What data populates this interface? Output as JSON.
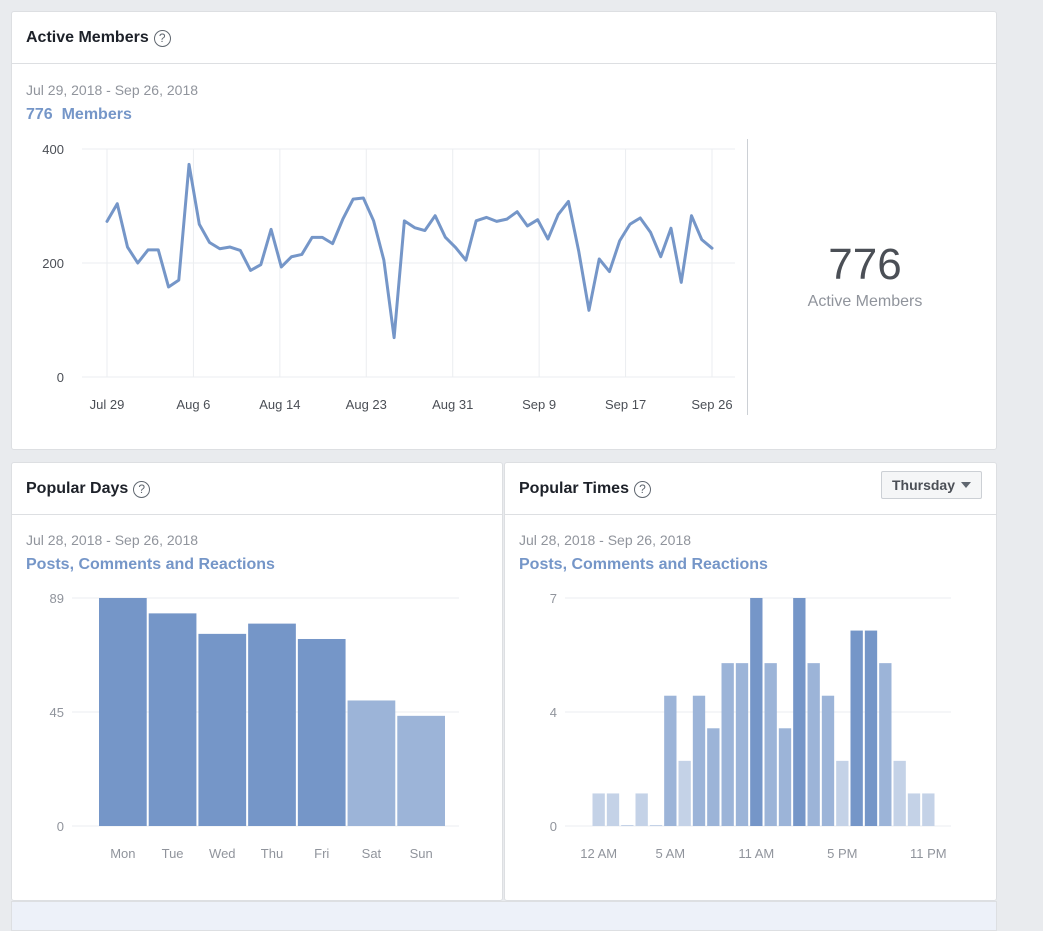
{
  "active_members": {
    "title": "Active Members",
    "help_icon": "?",
    "date_range": "Jul 29, 2018 - Sep 26, 2018",
    "metric_link": "776  Members",
    "summary_value": "776",
    "summary_label": "Active Members"
  },
  "popular_days": {
    "title": "Popular Days",
    "help_icon": "?",
    "date_range": "Jul 28, 2018 - Sep 26, 2018",
    "metric_link": "Posts, Comments and Reactions"
  },
  "popular_times": {
    "title": "Popular Times",
    "help_icon": "?",
    "date_range": "Jul 28, 2018 - Sep 26, 2018",
    "metric_link": "Posts, Comments and Reactions",
    "day_selector": "Thursday"
  },
  "colors": {
    "line": "#7596c8",
    "bar_dark": "#7596c8",
    "bar_medium": "#9cb4d8",
    "bar_light": "#c4d2e7",
    "grid": "#ebedf0",
    "tick_text": "#90949c",
    "axis_text": "#4b4f56"
  },
  "chart_data": [
    {
      "type": "line",
      "title": "Active Members",
      "xlabel": "",
      "ylabel": "",
      "ylim": [
        0,
        400
      ],
      "yticks": [
        "0",
        "200",
        "400"
      ],
      "xticks": [
        "Jul 29",
        "Aug 6",
        "Aug 14",
        "Aug 23",
        "Aug 31",
        "Sep 9",
        "Sep 17",
        "Sep 26"
      ],
      "grid": true,
      "x_start": "Jul 29",
      "x_end": "Sep 26",
      "values": [
        273,
        304,
        228,
        200,
        223,
        223,
        158,
        170,
        373,
        268,
        236,
        225,
        228,
        222,
        187,
        197,
        259,
        193,
        211,
        215,
        245,
        245,
        234,
        277,
        312,
        314,
        274,
        205,
        69,
        274,
        262,
        257,
        283,
        245,
        227,
        205,
        274,
        280,
        273,
        277,
        290,
        265,
        276,
        242,
        285,
        308,
        221,
        117,
        207,
        185,
        239,
        268,
        279,
        254,
        211,
        261,
        166,
        283,
        241,
        226
      ]
    },
    {
      "type": "bar",
      "title": "Popular Days",
      "categories": [
        "Mon",
        "Tue",
        "Wed",
        "Thu",
        "Fri",
        "Sat",
        "Sun"
      ],
      "values": [
        89,
        83,
        75,
        79,
        73,
        49,
        43
      ],
      "shade": [
        "dark",
        "dark",
        "dark",
        "dark",
        "dark",
        "medium",
        "medium"
      ],
      "ylim": [
        0,
        89
      ],
      "yticks": [
        "0",
        "45",
        "89"
      ],
      "grid": true
    },
    {
      "type": "bar",
      "title": "Popular Times",
      "categories": [
        "12 AM",
        "1 AM",
        "2 AM",
        "3 AM",
        "4 AM",
        "5 AM",
        "6 AM",
        "7 AM",
        "8 AM",
        "9 AM",
        "10 AM",
        "11 AM",
        "12 PM",
        "1 PM",
        "2 PM",
        "3 PM",
        "4 PM",
        "5 PM",
        "6 PM",
        "7 PM",
        "8 PM",
        "9 PM",
        "10 PM",
        "11 PM"
      ],
      "values": [
        1,
        1,
        0,
        1,
        0,
        4,
        2,
        4,
        3,
        5,
        5,
        7,
        5,
        3,
        7,
        5,
        4,
        2,
        6,
        6,
        5,
        2,
        1,
        1
      ],
      "xtick_labels": {
        "0": "12 AM",
        "5": "5 AM",
        "11": "11 AM",
        "17": "5 PM",
        "23": "11 PM"
      },
      "ylim": [
        0,
        7
      ],
      "yticks": [
        "0",
        "4",
        "7"
      ],
      "grid": true
    }
  ]
}
